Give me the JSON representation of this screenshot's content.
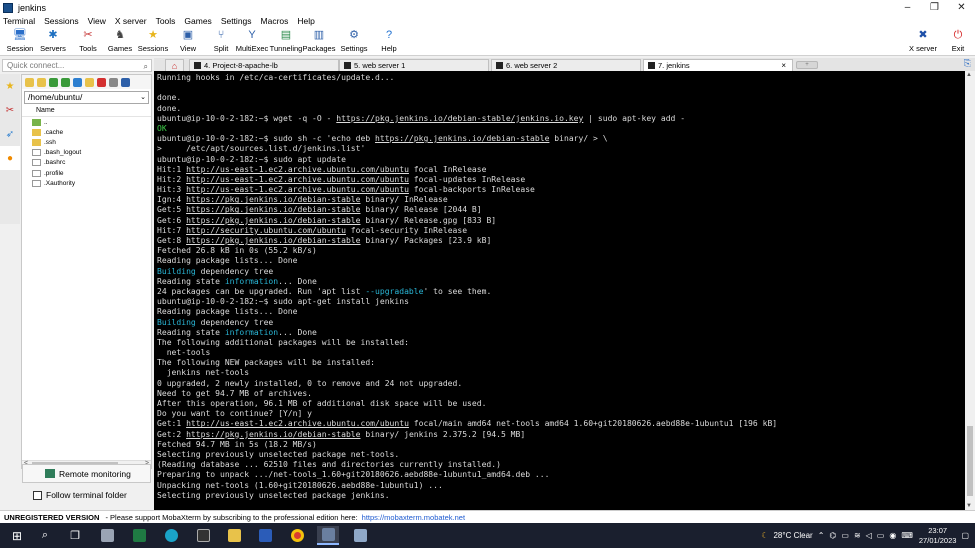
{
  "window": {
    "title": "jenkins",
    "controls": [
      "–",
      "❐",
      "✕"
    ]
  },
  "menu": [
    "Terminal",
    "Sessions",
    "View",
    "X server",
    "Tools",
    "Games",
    "Settings",
    "Macros",
    "Help"
  ],
  "toolbar": [
    {
      "label": "Session",
      "icon": "session-icon",
      "glyph": "🖥",
      "color": "#2b6fc9"
    },
    {
      "label": "Servers",
      "icon": "servers-icon",
      "glyph": "✱",
      "color": "#1d6fc0"
    },
    {
      "label": "Tools",
      "icon": "tools-icon",
      "glyph": "✂",
      "color": "#c43030"
    },
    {
      "label": "Games",
      "icon": "games-icon",
      "glyph": "♞",
      "color": "#444"
    },
    {
      "label": "Sessions",
      "icon": "sessions-icon",
      "glyph": "★",
      "color": "#e8b51c"
    },
    {
      "label": "View",
      "icon": "view-icon",
      "glyph": "▣",
      "color": "#2d5fa8"
    },
    {
      "label": "Split",
      "icon": "split-icon",
      "glyph": "⑂",
      "color": "#2d5fa8"
    },
    {
      "label": "MultiExec",
      "icon": "multiexec-icon",
      "glyph": "Y",
      "color": "#2d5fa8"
    },
    {
      "label": "Tunneling",
      "icon": "tunneling-icon",
      "glyph": "▤",
      "color": "#2a8a4a"
    },
    {
      "label": "Packages",
      "icon": "packages-icon",
      "glyph": "▥",
      "color": "#2d5fa8"
    },
    {
      "label": "Settings",
      "icon": "settings-icon",
      "glyph": "⚙",
      "color": "#2d5fa8"
    },
    {
      "label": "Help",
      "icon": "help-icon",
      "glyph": "?",
      "color": "#1d6fd0"
    }
  ],
  "toolbar_right": [
    {
      "label": "X server",
      "icon": "xserver-icon",
      "glyph": "✖",
      "color": "#1d4fa8"
    },
    {
      "label": "Exit",
      "icon": "exit-icon",
      "glyph": "⏻",
      "color": "#d42020"
    }
  ],
  "quick_connect": {
    "placeholder": "Quick connect..."
  },
  "sftp": {
    "path": "/home/ubuntu/",
    "column": "Name",
    "entries": [
      {
        "name": "..",
        "type": "up"
      },
      {
        "name": ".cache",
        "type": "folder"
      },
      {
        "name": ".ssh",
        "type": "folder"
      },
      {
        "name": ".bash_logout",
        "type": "file"
      },
      {
        "name": ".bashrc",
        "type": "file"
      },
      {
        "name": ".profile",
        "type": "file"
      },
      {
        "name": ".Xauthority",
        "type": "file"
      }
    ],
    "remote_monitoring": "Remote monitoring",
    "follow_folder": "Follow terminal folder"
  },
  "tabs": [
    {
      "label": "4. Project-8-apache-lb",
      "active": false
    },
    {
      "label": "5. web server 1",
      "active": false
    },
    {
      "label": "6. web server 2",
      "active": false
    },
    {
      "label": "7. jenkins",
      "active": true
    }
  ],
  "terminal_lines": [
    [
      {
        "t": "Running hooks in /etc/ca-certificates/update.d..."
      }
    ],
    [
      {
        "t": ""
      }
    ],
    [
      {
        "t": "done."
      }
    ],
    [
      {
        "t": "done."
      }
    ],
    [
      {
        "t": "ubuntu@ip-10-0-2-182:~$ wget -q -O - "
      },
      {
        "t": "https://pkg.jenkins.io/debian-stable/jenkins.io.key",
        "c": "url"
      },
      {
        "t": " | sudo apt-key add -"
      }
    ],
    [
      {
        "t": "OK",
        "c": "gr"
      }
    ],
    [
      {
        "t": "ubuntu@ip-10-0-2-182:~$ sudo sh -c 'echo deb "
      },
      {
        "t": "https://pkg.jenkins.io/debian-stable",
        "c": "url"
      },
      {
        "t": " binary/ > \\"
      }
    ],
    [
      {
        "t": ">     /etc/apt/sources.list.d/jenkins.list'"
      }
    ],
    [
      {
        "t": "ubuntu@ip-10-0-2-182:~$ sudo apt update"
      }
    ],
    [
      {
        "t": "Hit:1 "
      },
      {
        "t": "http://us-east-1.ec2.archive.ubuntu.com/ubuntu",
        "c": "url"
      },
      {
        "t": " focal InRelease"
      }
    ],
    [
      {
        "t": "Hit:2 "
      },
      {
        "t": "http://us-east-1.ec2.archive.ubuntu.com/ubuntu",
        "c": "url"
      },
      {
        "t": " focal-updates InRelease"
      }
    ],
    [
      {
        "t": "Hit:3 "
      },
      {
        "t": "http://us-east-1.ec2.archive.ubuntu.com/ubuntu",
        "c": "url"
      },
      {
        "t": " focal-backports InRelease"
      }
    ],
    [
      {
        "t": "Ign:4 "
      },
      {
        "t": "https://pkg.jenkins.io/debian-stable",
        "c": "url"
      },
      {
        "t": " binary/ InRelease"
      }
    ],
    [
      {
        "t": "Get:5 "
      },
      {
        "t": "https://pkg.jenkins.io/debian-stable",
        "c": "url"
      },
      {
        "t": " binary/ Release [2044 B]"
      }
    ],
    [
      {
        "t": "Get:6 "
      },
      {
        "t": "https://pkg.jenkins.io/debian-stable",
        "c": "url"
      },
      {
        "t": " binary/ Release.gpg [833 B]"
      }
    ],
    [
      {
        "t": "Hit:7 "
      },
      {
        "t": "http://security.ubuntu.com/ubuntu",
        "c": "url"
      },
      {
        "t": " focal-security InRelease"
      }
    ],
    [
      {
        "t": "Get:8 "
      },
      {
        "t": "https://pkg.jenkins.io/debian-stable",
        "c": "url"
      },
      {
        "t": " binary/ Packages [23.9 kB]"
      }
    ],
    [
      {
        "t": "Fetched 26.8 kB in 0s (55.2 kB/s)"
      }
    ],
    [
      {
        "t": "Reading package lists... Done"
      }
    ],
    [
      {
        "t": "Building",
        "c": "cy"
      },
      {
        "t": " dependency tree"
      }
    ],
    [
      {
        "t": "Reading state "
      },
      {
        "t": "information",
        "c": "cy"
      },
      {
        "t": "... Done"
      }
    ],
    [
      {
        "t": "24 packages can be upgraded. Run 'apt list "
      },
      {
        "t": "--upgradable",
        "c": "cy"
      },
      {
        "t": "' to see them."
      }
    ],
    [
      {
        "t": "ubuntu@ip-10-0-2-182:~$ sudo apt-get install jenkins"
      }
    ],
    [
      {
        "t": "Reading package lists... Done"
      }
    ],
    [
      {
        "t": "Building",
        "c": "cy"
      },
      {
        "t": " dependency tree"
      }
    ],
    [
      {
        "t": "Reading state "
      },
      {
        "t": "information",
        "c": "cy"
      },
      {
        "t": "... Done"
      }
    ],
    [
      {
        "t": "The following additional packages will be installed:"
      }
    ],
    [
      {
        "t": "  net-tools"
      }
    ],
    [
      {
        "t": "The following NEW packages will be installed:"
      }
    ],
    [
      {
        "t": "  jenkins net-tools"
      }
    ],
    [
      {
        "t": "0 upgraded, 2 newly installed, 0 to remove and 24 not upgraded."
      }
    ],
    [
      {
        "t": "Need to get 94.7 MB of archives."
      }
    ],
    [
      {
        "t": "After this operation, 96.1 MB of additional disk space will be used."
      }
    ],
    [
      {
        "t": "Do you want to continue? [Y/n] y"
      }
    ],
    [
      {
        "t": "Get:1 "
      },
      {
        "t": "http://us-east-1.ec2.archive.ubuntu.com/ubuntu",
        "c": "url"
      },
      {
        "t": " focal/main amd64 net-tools amd64 1.60+git20180626.aebd88e-1ubuntu1 [196 kB]"
      }
    ],
    [
      {
        "t": "Get:2 "
      },
      {
        "t": "https://pkg.jenkins.io/debian-stable",
        "c": "url"
      },
      {
        "t": " binary/ jenkins 2.375.2 [94.5 MB]"
      }
    ],
    [
      {
        "t": "Fetched 94.7 MB in 5s (18.2 MB/s)"
      }
    ],
    [
      {
        "t": "Selecting previously unselected package net-tools."
      }
    ],
    [
      {
        "t": "(Reading database ... 62510 files and directories currently installed.)"
      }
    ],
    [
      {
        "t": "Preparing to unpack .../net-tools_1.60+git20180626.aebd88e-1ubuntu1_amd64.deb ..."
      }
    ],
    [
      {
        "t": "Unpacking net-tools (1.60+git20180626.aebd88e-1ubuntu1) ..."
      }
    ],
    [
      {
        "t": "Selecting previously unselected package jenkins."
      }
    ]
  ],
  "status": {
    "unregistered": "UNREGISTERED VERSION",
    "message": " -  Please support MobaXterm by subscribing to the professional edition here:",
    "link": "https://mobaxterm.mobatek.net"
  },
  "taskbar": {
    "weather": "28°C  Clear",
    "time": "23:07",
    "date": "27/01/2023"
  }
}
